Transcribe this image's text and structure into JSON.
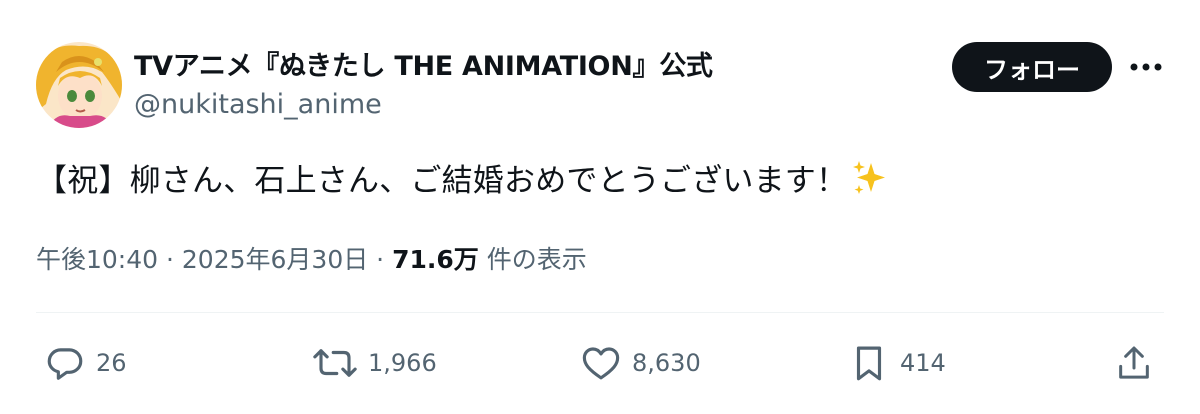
{
  "tweet": {
    "display_name": "TVアニメ『ぬきたし THE ANIMATION』公式",
    "handle": "@nukitashi_anime",
    "follow_label": "フォロー",
    "text": "【祝】柳さん、石上さん、ご結婚おめでとうございます！",
    "time": "午後10:40",
    "separator1": " · ",
    "date": "2025年6月30日",
    "separator2": " · ",
    "views": "71.6万",
    "views_suffix": " 件の表示"
  },
  "actions": {
    "replies": "26",
    "retweets": "1,966",
    "likes": "8,630",
    "bookmarks": "414"
  },
  "colors": {
    "text": "#0f1419",
    "secondary": "#536471",
    "follow_bg": "#0f1419",
    "divider": "#eff3f4"
  },
  "icons": [
    "avatar",
    "more-icon",
    "sparkles-icon",
    "reply-icon",
    "retweet-icon",
    "like-icon",
    "bookmark-icon",
    "share-icon"
  ]
}
